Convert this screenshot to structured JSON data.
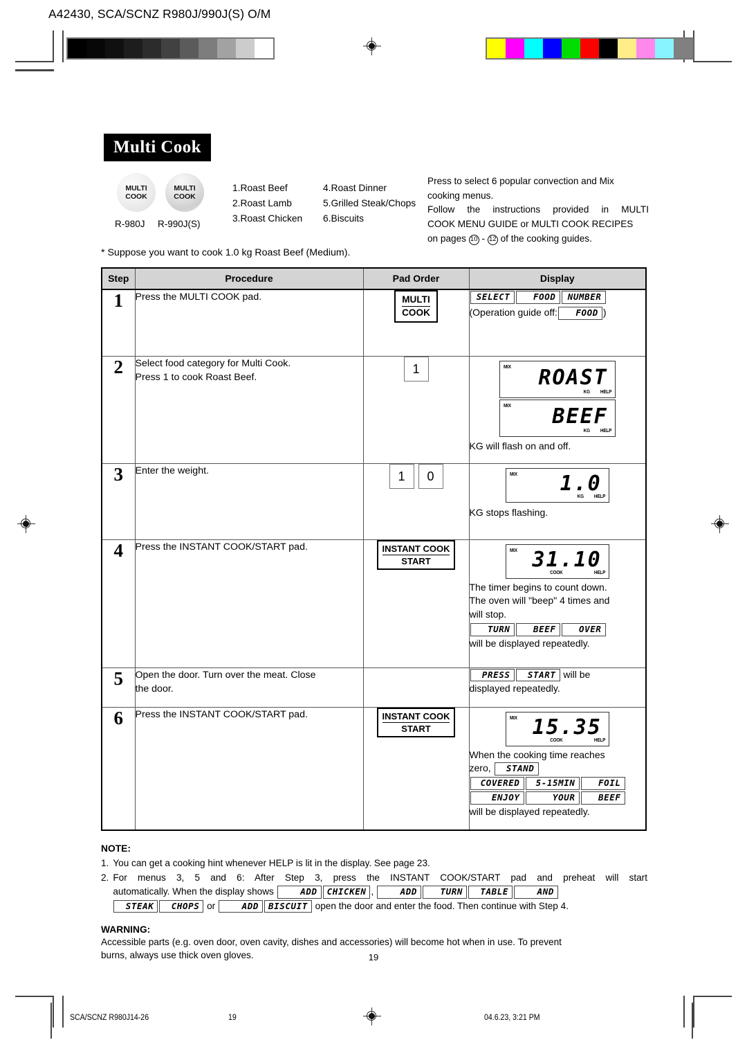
{
  "header": {
    "doc_code": "A42430, SCA/SCNZ R980J/990J(S) O/M",
    "gray_swatches": [
      "#000000",
      "#070707",
      "#101010",
      "#1d1d1d",
      "#2c2c2c",
      "#414141",
      "#5b5b5b",
      "#7d7d7d",
      "#a2a2a2",
      "#cccccc",
      "#ffffff"
    ],
    "color_swatches": [
      "#ffff00",
      "#ff00ff",
      "#00ffff",
      "#0000ff",
      "#00dd00",
      "#ff0000",
      "#000000",
      "#ffee88",
      "#ff88ee",
      "#88f4ff",
      "#808080"
    ]
  },
  "title": "Multi Cook",
  "pads": {
    "pad1_line1": "MULTI",
    "pad1_line2": "COOK",
    "pad1_model": "R-980J",
    "pad2_line1": "MULTI",
    "pad2_line2": "COOK",
    "pad2_model": "R-990J(S)"
  },
  "menu_left": [
    "1.Roast Beef",
    "2.Roast Lamb",
    "3.Roast Chicken"
  ],
  "menu_right": [
    "4.Roast Dinner",
    "5.Grilled Steak/Chops",
    "6.Biscuits"
  ],
  "intro": {
    "line1": "Press to select 6 popular convection and Mix",
    "line2": "cooking menus.",
    "line3": "Follow the instructions provided in MULTI",
    "line4": "COOK MENU GUIDE or MULTI COOK RECIPES",
    "line5a": "on pages",
    "page_from": "10",
    "dash": "-",
    "page_to": "12",
    "line5b": "of the cooking guides."
  },
  "suppose": "*  Suppose you want to cook 1.0 kg Roast Beef (Medium).",
  "table": {
    "headers": [
      "Step",
      "Procedure",
      "Pad Order",
      "Display"
    ],
    "rows": [
      {
        "step": "1",
        "procedure": [
          "Press the MULTI COOK pad."
        ],
        "pad": {
          "type": "key-two-line",
          "l1": "MULTI",
          "l2": "COOK"
        },
        "display": {
          "segs_row1": [
            "SELECT",
            "FOOD",
            "NUMBER"
          ],
          "guide_prefix": "(Operation guide off:",
          "guide_seg": "FOOD",
          "guide_suffix": ")"
        }
      },
      {
        "step": "2",
        "procedure": [
          "Select food category for Multi Cook.",
          "Press 1 to cook Roast Beef."
        ],
        "pad": {
          "type": "numpad",
          "keys": [
            "1"
          ]
        },
        "display": {
          "lcd1": {
            "value": "ROAST",
            "mix": "MIX",
            "kg": "KG",
            "help": "HELP"
          },
          "lcd2": {
            "value": "BEEF",
            "mix": "MIX",
            "kg": "KG",
            "help": "HELP"
          },
          "caption": "KG will flash on and off."
        }
      },
      {
        "step": "3",
        "procedure": [
          "Enter the weight."
        ],
        "pad": {
          "type": "numpad",
          "keys": [
            "1",
            "0"
          ]
        },
        "display": {
          "lcd1": {
            "value": "1.0",
            "mix": "MIX",
            "kg": "KG",
            "help": "HELP"
          },
          "caption": "KG stops flashing."
        }
      },
      {
        "step": "4",
        "procedure": [
          "Press the INSTANT COOK/START pad."
        ],
        "pad": {
          "type": "key-two-line",
          "l1": "INSTANT COOK",
          "l2": "START"
        },
        "display": {
          "lcd1": {
            "value": "31.10",
            "mix": "MIX",
            "cook": "COOK",
            "help": "HELP"
          },
          "caption_lines": [
            "The timer begins to count down.",
            "The oven will \"beep\" 4 times and",
            "will stop."
          ],
          "segs_row1": [
            "TURN",
            "BEEF",
            "OVER"
          ],
          "caption_after": "will be displayed repeatedly."
        }
      },
      {
        "step": "5",
        "procedure": [
          "Open the door. Turn over the meat. Close",
          "the door."
        ],
        "pad": {
          "type": "none"
        },
        "display": {
          "segs_inline": [
            "PRESS",
            "START"
          ],
          "inline_suffix": "will be",
          "caption_after": "displayed repeatedly."
        }
      },
      {
        "step": "6",
        "procedure": [
          "Press the INSTANT COOK/START pad."
        ],
        "pad": {
          "type": "key-two-line",
          "l1": "INSTANT COOK",
          "l2": "START"
        },
        "display": {
          "lcd1": {
            "value": "15.35",
            "mix": "MIX",
            "cook": "COOK",
            "help": "HELP"
          },
          "caption_lines": [
            "When the cooking time reaches"
          ],
          "zero_prefix": "zero,",
          "zero_seg": "STAND",
          "segs_row2": [
            "COVERED",
            "5-15MIN",
            "FOIL"
          ],
          "segs_row3": [
            "ENJOY",
            "YOUR",
            "BEEF"
          ],
          "caption_after": "will be displayed repeatedly."
        }
      }
    ]
  },
  "note": {
    "heading": "NOTE:",
    "item1_num": "1.",
    "item1_text": "You can get a cooking hint whenever HELP is lit in the display. See page 23.",
    "item2_num": "2.",
    "item2_text_a": "For menus 3, 5 and 6: After Step 3, press the INSTANT COOK/START pad and preheat will start",
    "item2_text_b": "automatically. When the display shows",
    "item2_segs_1": [
      "ADD",
      "CHICKEN"
    ],
    "item2_comma": ",",
    "item2_segs_2": [
      "ADD",
      "TURN",
      "TABLE",
      "AND"
    ],
    "item2_segs_3": [
      "STEAK",
      "CHOPS"
    ],
    "item2_or": "or",
    "item2_segs_4": [
      "ADD",
      "BISCUIT"
    ],
    "item2_text_c": "open the door and enter the food. Then continue with Step 4."
  },
  "warning": {
    "heading": "WARNING:",
    "line1": "Accessible parts (e.g. oven door, oven cavity, dishes and accessories) will become hot when in use. To prevent",
    "line2": "burns, always use thick oven gloves."
  },
  "page_number": "19",
  "footer": {
    "left": "SCA/SCNZ R980J14-26",
    "center": "19",
    "right": "04.6.23, 3:21 PM"
  }
}
